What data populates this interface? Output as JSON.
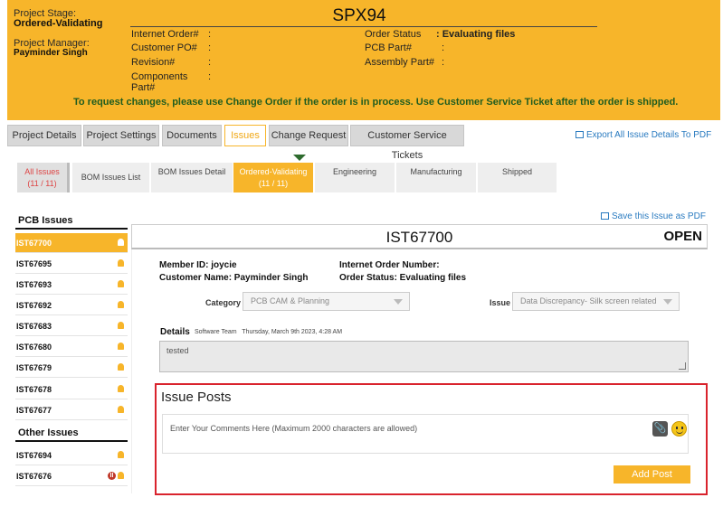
{
  "header": {
    "stage_label": "Project Stage:",
    "stage_value": "Ordered-Validating",
    "pm_label": "Project Manager:",
    "pm_value": "Payminder Singh",
    "order_title": "SPX94",
    "fields_left": [
      {
        "label": "Internet Order#",
        "colon": ":"
      },
      {
        "label": "Customer PO#",
        "colon": ":"
      },
      {
        "label": "Revision#",
        "colon": ":"
      },
      {
        "label": "Components Part#",
        "colon": ":"
      }
    ],
    "fields_right": [
      {
        "label": "Order Status",
        "value": ": Evaluating files"
      },
      {
        "label": "PCB Part#",
        "value": ":"
      },
      {
        "label": "Assembly Part#",
        "value": ":"
      }
    ],
    "notice": "To request changes, please use Change Order if the order is in process. Use Customer Service Ticket after the order is shipped."
  },
  "tabs": [
    "Project Details",
    "Project Settings",
    "Documents",
    "Issues",
    "Change Request",
    "Customer Service Tickets"
  ],
  "export_all": "Export All Issue Details To PDF",
  "subtabs": [
    {
      "line1": "All Issues",
      "line2": "(11 / 11)"
    },
    {
      "line1": "BOM Issues List",
      "line2": ""
    },
    {
      "line1": "BOM Issues Detail",
      "line2": ""
    },
    {
      "line1": "Ordered-Validating",
      "line2": "(11 / 11)"
    },
    {
      "line1": "Engineering",
      "line2": ""
    },
    {
      "line1": "Manufacturing",
      "line2": ""
    },
    {
      "line1": "Shipped",
      "line2": ""
    }
  ],
  "pcb_issues_title": "PCB Issues",
  "pcb_issues": [
    "IST67700",
    "IST67695",
    "IST67693",
    "IST67692",
    "IST67683",
    "IST67680",
    "IST67679",
    "IST67678",
    "IST67677"
  ],
  "other_issues_title": "Other Issues",
  "other_issues": [
    "IST67694",
    "IST67676"
  ],
  "issue": {
    "save_pdf": "Save this Issue as PDF",
    "id": "IST67700",
    "status": "OPEN",
    "member_id": "Member ID: joycie",
    "customer_name": "Customer Name: Payminder Singh",
    "internet_order": "Internet Order Number:",
    "order_status": "Order Status: Evaluating files",
    "category_label": "Category",
    "category_value": "PCB CAM & Planning",
    "issue_label": "Issue",
    "issue_value": "Data Discrepancy- Silk screen related",
    "details_label": "Details",
    "details_team": "Software Team",
    "details_date": "Thursday, March 9th 2023, 4:28 AM",
    "details_text": "tested"
  },
  "posts": {
    "title": "Issue Posts",
    "comment_placeholder": "Enter Your Comments Here (Maximum 2000 characters are allowed)",
    "add_post": "Add Post"
  },
  "colors": {
    "accent": "#f7b52a",
    "link": "#2a7bc0",
    "highlight_border": "#d9232d"
  }
}
